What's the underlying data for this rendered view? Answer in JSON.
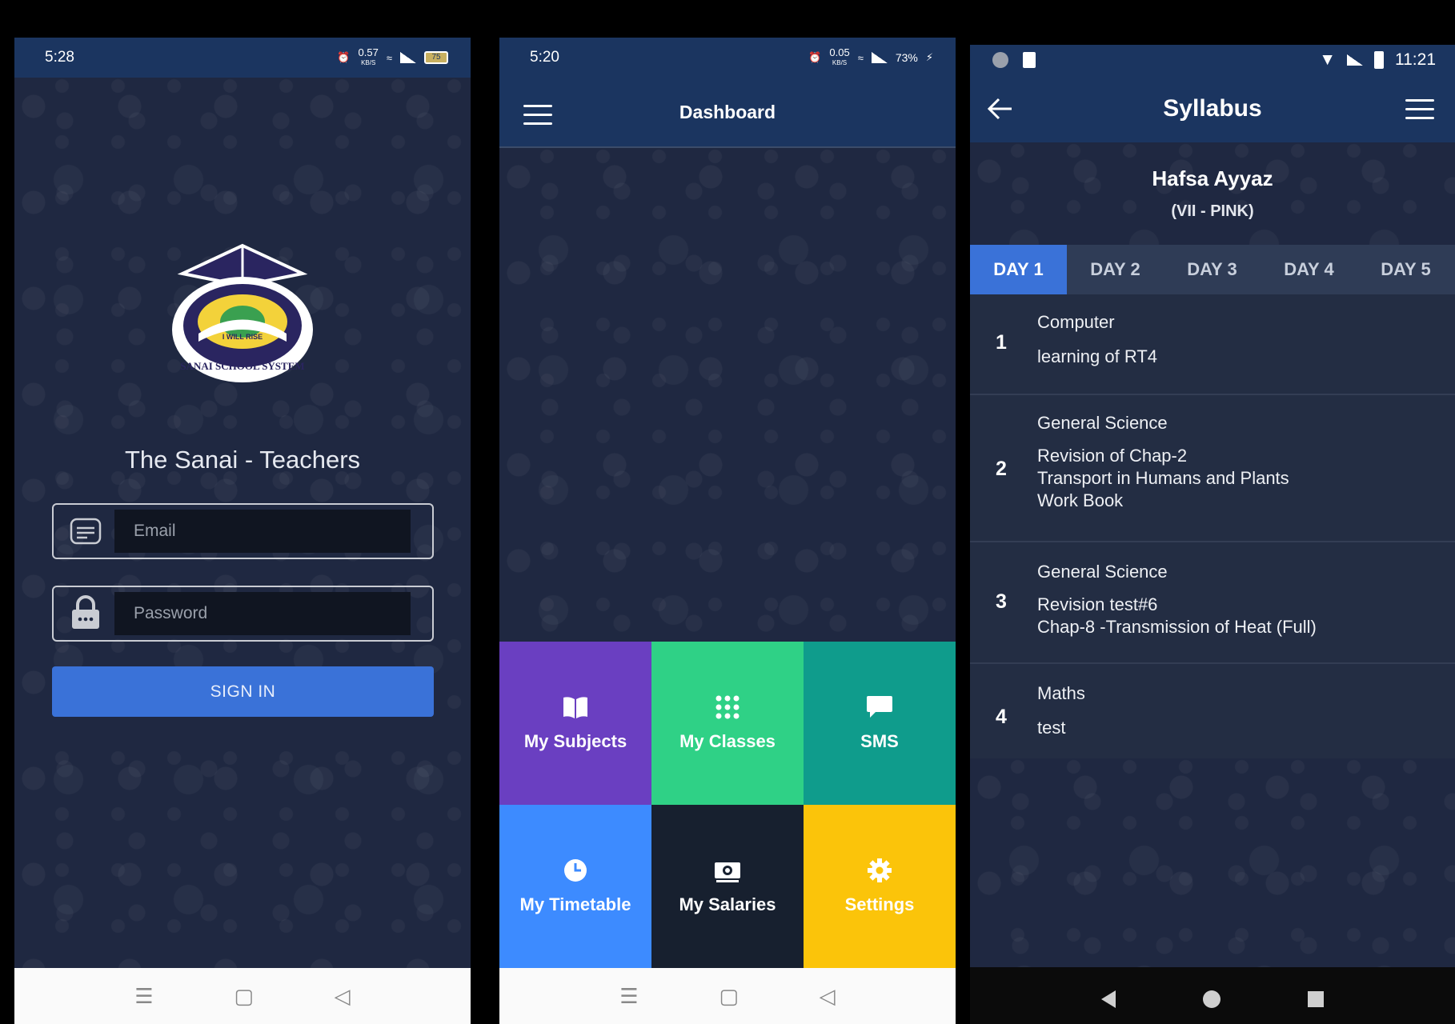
{
  "login": {
    "status_time": "5:28",
    "status_speed": "0.57",
    "status_speed_unit": "KB/S",
    "battery": "75",
    "app_title": "The Sanai - Teachers",
    "logo_text_top": "I WILL RISE",
    "logo_text_bottom": "SANAI SCHOOL SYSTEM",
    "email_placeholder": "Email",
    "password_placeholder": "Password",
    "signin_label": "SIGN IN"
  },
  "dashboard": {
    "status_time": "5:20",
    "status_speed": "0.05",
    "status_speed_unit": "KB/S",
    "battery": "73%",
    "title": "Dashboard",
    "tiles": [
      {
        "label": "My Subjects",
        "color": "#6a3fc1",
        "icon": "book-icon"
      },
      {
        "label": "My Classes",
        "color": "#2fd186",
        "icon": "grid-icon"
      },
      {
        "label": "SMS",
        "color": "#0f9c8c",
        "icon": "chat-icon"
      },
      {
        "label": "My Timetable",
        "color": "#3d8bff",
        "icon": "clock-icon"
      },
      {
        "label": "My Salaries",
        "color": "#17202f",
        "icon": "money-icon"
      },
      {
        "label": "Settings",
        "color": "#fbc40a",
        "icon": "gear-icon"
      }
    ]
  },
  "syllabus": {
    "status_time": "11:21",
    "title": "Syllabus",
    "student_name": "Hafsa Ayyaz",
    "student_class": "(VII - PINK)",
    "tabs": [
      "DAY 1",
      "DAY 2",
      "DAY 3",
      "DAY 4",
      "DAY 5"
    ],
    "active_tab": "DAY 1",
    "items": [
      {
        "num": "1",
        "subject": "Computer",
        "detail": [
          "learning of RT4"
        ]
      },
      {
        "num": "2",
        "subject": "General Science",
        "detail": [
          "Revision of Chap-2",
          "Transport in Humans and Plants",
          "Work Book"
        ]
      },
      {
        "num": "3",
        "subject": "General Science",
        "detail": [
          "Revision test#6",
          "Chap-8 -Transmission of Heat (Full)"
        ]
      },
      {
        "num": "4",
        "subject": "Maths",
        "detail": [
          "test"
        ]
      }
    ]
  },
  "colors": {
    "primary_bar": "#1b3560",
    "accent_blue": "#3a72d8",
    "background": "#1e2740"
  }
}
